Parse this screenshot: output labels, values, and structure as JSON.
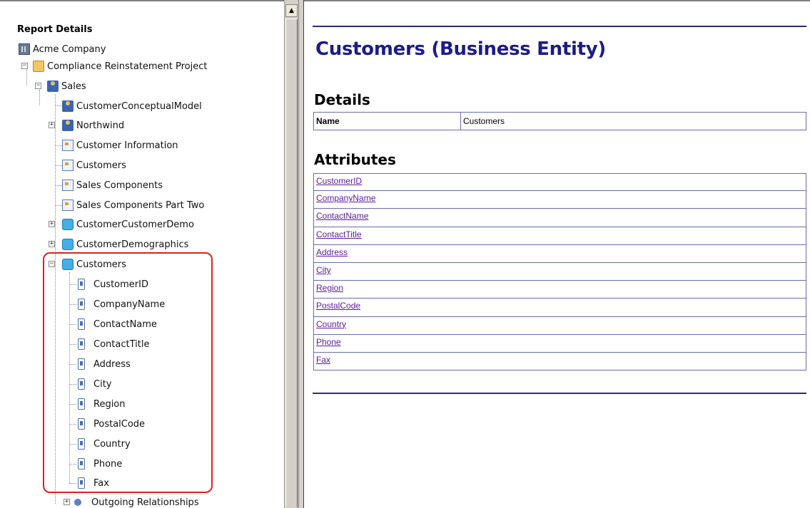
{
  "tree": {
    "title": "Report Details",
    "nodes": [
      {
        "label": "Acme Company",
        "icon": "building-icon"
      },
      {
        "label": "Compliance Reinstatement Project",
        "icon": "folder-icon"
      },
      {
        "label": "Sales",
        "icon": "model-icon"
      },
      {
        "label": "CustomerConceptualModel",
        "icon": "model-icon"
      },
      {
        "label": "Northwind",
        "icon": "model-icon"
      },
      {
        "label": "Customer Information",
        "icon": "diagram-icon"
      },
      {
        "label": "Customers",
        "icon": "diagram-icon"
      },
      {
        "label": "Sales Components",
        "icon": "diagram-icon"
      },
      {
        "label": "Sales Components Part Two",
        "icon": "diagram-icon"
      },
      {
        "label": "CustomerCustomerDemo",
        "icon": "entity-icon"
      },
      {
        "label": "CustomerDemographics",
        "icon": "entity-icon"
      },
      {
        "label": "Customers",
        "icon": "entity-icon"
      },
      {
        "label": "CustomerID",
        "icon": "attribute-icon"
      },
      {
        "label": "CompanyName",
        "icon": "attribute-icon"
      },
      {
        "label": "ContactName",
        "icon": "attribute-icon"
      },
      {
        "label": "ContactTitle",
        "icon": "attribute-icon"
      },
      {
        "label": "Address",
        "icon": "attribute-icon"
      },
      {
        "label": "City",
        "icon": "attribute-icon"
      },
      {
        "label": "Region",
        "icon": "attribute-icon"
      },
      {
        "label": "PostalCode",
        "icon": "attribute-icon"
      },
      {
        "label": "Country",
        "icon": "attribute-icon"
      },
      {
        "label": "Phone",
        "icon": "attribute-icon"
      },
      {
        "label": "Fax",
        "icon": "attribute-icon"
      },
      {
        "label": "Outgoing Relationships",
        "icon": "relationship-icon"
      }
    ]
  },
  "scrollbar": {
    "up_arrow": "▲"
  },
  "main": {
    "title": "Customers (Business Entity)",
    "details_heading": "Details",
    "details": {
      "key": "Name",
      "value": "Customers"
    },
    "attributes_heading": "Attributes",
    "attributes": [
      "CustomerID",
      "CompanyName",
      "ContactName",
      "ContactTitle",
      "Address",
      "City",
      "Region",
      "PostalCode",
      "Country",
      "Phone",
      "Fax"
    ]
  },
  "colors": {
    "title": "#1c1c87",
    "link": "#5a1aa0",
    "highlight": "#e02020",
    "border": "#6a6ab5"
  }
}
